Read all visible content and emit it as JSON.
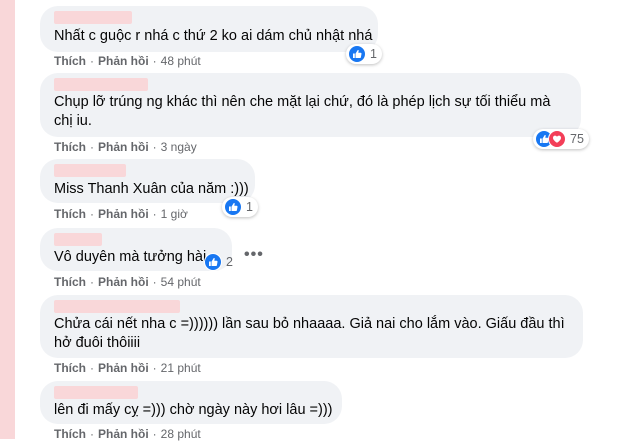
{
  "actions": {
    "like": "Thích",
    "reply": "Phản hồi",
    "separator": "·"
  },
  "comments": [
    {
      "text": "Nhất c guộc r nhá c thứ 2 ko ai dám chủ nhật nhá",
      "time": "48 phút",
      "reactions": "1"
    },
    {
      "text": "Chụp lỡ trúng ng khác thì nên che mặt lại chứ, đó là phép lịch sự tối thiểu mà chị iu.",
      "time": "3 ngày",
      "reactions": "75"
    },
    {
      "text": "Miss Thanh Xuân của năm :)))",
      "time": "1 giờ",
      "reactions": "1"
    },
    {
      "text": "Vô duyên mà tưởng hài",
      "time": "54 phút",
      "reactions": "2"
    },
    {
      "text": "Chửa cái nết nha c =)))))) lần sau bỏ nhaaaa. Giả nai cho lắm vào. Giấu đầu thì hở đuôi thôiiii",
      "time": "21 phút"
    },
    {
      "text": "lên đi mấy cỵ =))) chờ ngày này hơi lâu =)))",
      "time": "28 phút"
    }
  ],
  "more_label": "•••",
  "colors": {
    "bubble": "#f0f2f5",
    "name_blur": "#f9d7d9",
    "like_blue": "#1877f2",
    "heart_red": "#f33e58",
    "meta_gray": "#65676b"
  },
  "icons": [
    "like-icon",
    "heart-icon",
    "more-icon"
  ]
}
